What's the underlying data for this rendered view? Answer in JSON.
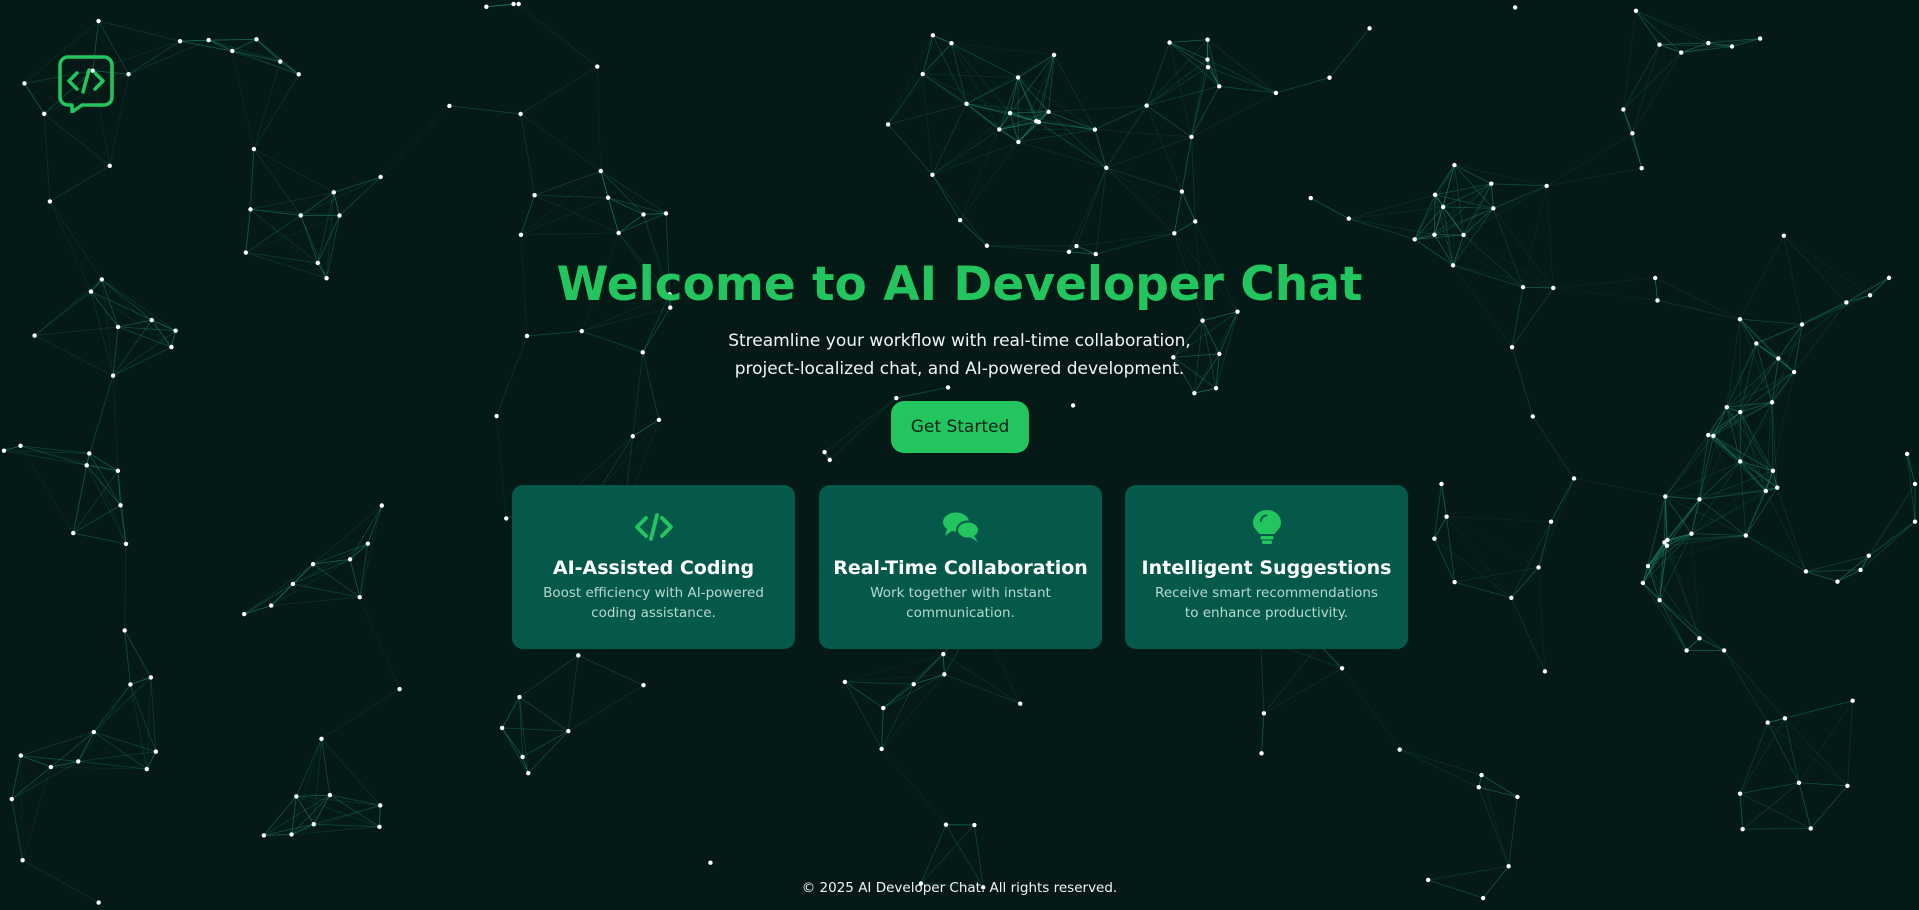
{
  "hero": {
    "title": "Welcome to AI Developer Chat",
    "subtitle": "Streamline your workflow with real-time collaboration, project-localized chat, and AI-powered development.",
    "cta_label": "Get Started"
  },
  "features": [
    {
      "icon": "code-icon",
      "title": "AI-Assisted Coding",
      "description": "Boost efficiency with AI-powered coding assistance."
    },
    {
      "icon": "chat-bubbles-icon",
      "title": "Real-Time Collaboration",
      "description": "Work together with instant communication."
    },
    {
      "icon": "lightbulb-icon",
      "title": "Intelligent Suggestions",
      "description": "Receive smart recommendations to enhance productivity."
    }
  ],
  "footer": {
    "copyright": "© 2025 AI Developer Chat. All rights reserved."
  },
  "colors": {
    "background": "#051a16",
    "accent": "#22c55e",
    "card": "#04594a",
    "network_line": "#1f8a73",
    "network_node": "#ffffff"
  },
  "icons": {
    "logo": "code-chat-logo-icon"
  }
}
